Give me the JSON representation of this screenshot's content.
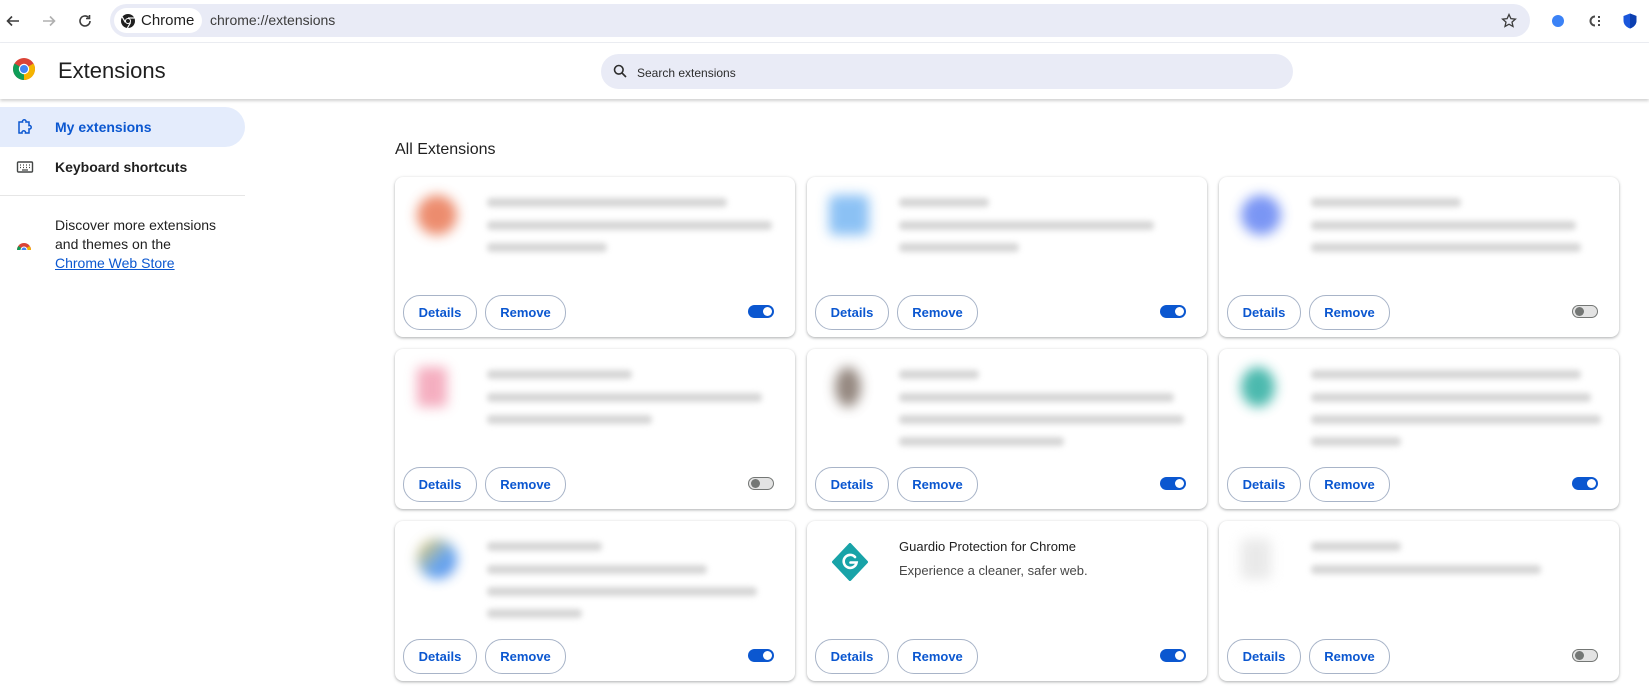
{
  "browser": {
    "chip_label": "Chrome",
    "url": "chrome://extensions"
  },
  "header": {
    "title": "Extensions",
    "search_placeholder": "Search extensions"
  },
  "sidebar": {
    "items": [
      {
        "label": "My extensions",
        "active": true
      },
      {
        "label": "Keyboard shortcuts",
        "active": false
      }
    ],
    "discover_text": "Discover more extensions and themes on the",
    "store_link": "Chrome Web Store"
  },
  "main": {
    "section_title": "All Extensions",
    "details_label": "Details",
    "remove_label": "Remove",
    "cards": [
      {
        "name": "",
        "description": "",
        "enabled": true,
        "icon_color": "#e8704a"
      },
      {
        "name": "",
        "description": "",
        "enabled": true,
        "icon_color": "#6fb2f2"
      },
      {
        "name": "",
        "description": "",
        "enabled": false,
        "icon_color": "#5a7cf2"
      },
      {
        "name": "",
        "description": "",
        "enabled": false,
        "icon_color": "#f29ab0"
      },
      {
        "name": "",
        "description": "",
        "enabled": true,
        "icon_color": "#7a6a60"
      },
      {
        "name": "",
        "description": "",
        "enabled": true,
        "icon_color": "#1fa89a"
      },
      {
        "name": "",
        "description": "",
        "enabled": true,
        "icon_color": "#3f8ff0"
      },
      {
        "name": "Guardio Protection for Chrome",
        "description": "Experience a cleaner, safer web.",
        "enabled": true,
        "icon_color": "#18a3a8"
      },
      {
        "name": "",
        "description": "",
        "enabled": false,
        "icon_color": "#e4e4e4"
      }
    ]
  },
  "colors": {
    "accent": "#0b57d0",
    "toolbar_bg": "#e9ebf6"
  }
}
